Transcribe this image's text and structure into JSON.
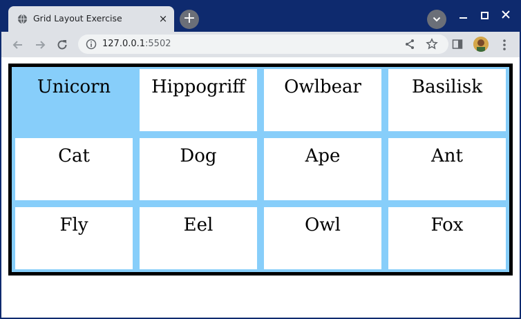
{
  "browser": {
    "tab": {
      "title": "Grid Layout Exercise",
      "close_label": "×",
      "favicon": "globe-icon"
    },
    "new_tab_label": "+",
    "toolbar": {
      "url_host": "127.0.0.1",
      "url_port": ":5502",
      "icons": [
        "back-arrow-icon",
        "forward-arrow-icon",
        "reload-icon",
        "info-icon",
        "share-icon",
        "star-icon",
        "side-panel-icon",
        "avatar",
        "menu-dots-icon"
      ]
    },
    "colors": {
      "frame": "#0e2a6e",
      "toolbar": "#dee1e6"
    }
  },
  "page": {
    "grid": {
      "cells": [
        "Unicorn",
        "Hippogriff",
        "Owlbear",
        "Basilisk",
        "Cat",
        "Dog",
        "Ape",
        "Ant",
        "Fly",
        "Eel",
        "Owl",
        "Fox"
      ],
      "highlighted_cell": "Unicorn",
      "colors": {
        "background": "#87cefa",
        "cell": "#ffffff",
        "border": "#000000"
      }
    }
  }
}
